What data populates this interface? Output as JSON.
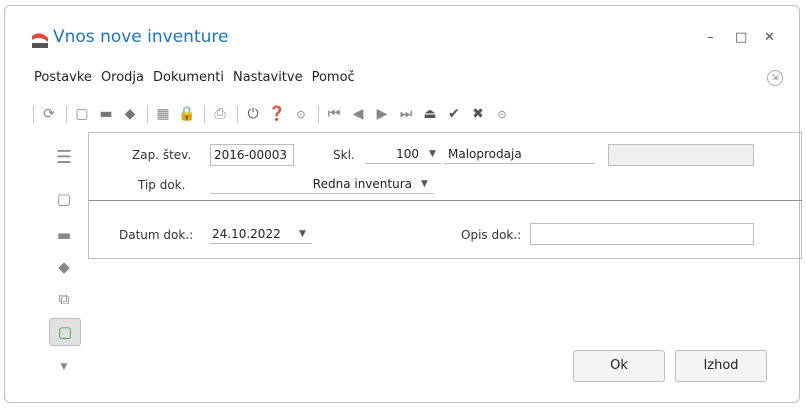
{
  "window": {
    "title": "Vnos nove inventure",
    "minimize": "–",
    "maximize": "□",
    "close": "✕"
  },
  "menu": {
    "items": [
      "Postavke",
      "Orodja",
      "Dokumenti",
      "Nastavitve",
      "Pomoč"
    ]
  },
  "form": {
    "zap_label": "Zap. štev.",
    "zap_value": "2016-00003",
    "skl_label": "Skl.",
    "skl_value": "100",
    "skl_name": "Maloprodaja",
    "tip_label": "Tip dok.",
    "tip_value": "Redna inventura",
    "datum_label": "Datum dok.:",
    "datum_value": "24.10.2022",
    "opis_label": "Opis dok.:",
    "opis_value": ""
  },
  "buttons": {
    "ok": "Ok",
    "izhod": "Izhod"
  },
  "colors": {
    "title": "#1e73be",
    "accent": "#4a90d9"
  }
}
